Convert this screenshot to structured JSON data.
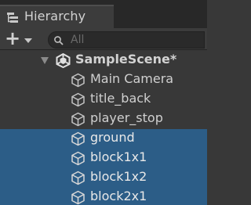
{
  "window": {
    "tab_label": "Hierarchy",
    "tab_icon": "hierarchy-icon"
  },
  "toolbar": {
    "add_icon": "plus-icon",
    "add_label": "+",
    "search_placeholder": "All",
    "search_value": ""
  },
  "scene": {
    "name": "SampleScene*",
    "expanded": true,
    "icon": "unity-scene-icon"
  },
  "items": [
    {
      "label": "Main Camera",
      "selected": false,
      "icon": "gameobject-cube-icon"
    },
    {
      "label": "title_back",
      "selected": false,
      "icon": "gameobject-cube-icon"
    },
    {
      "label": "player_stop",
      "selected": false,
      "icon": "gameobject-cube-icon"
    },
    {
      "label": "ground",
      "selected": true,
      "icon": "gameobject-cube-icon"
    },
    {
      "label": "block1x1",
      "selected": true,
      "icon": "gameobject-cube-icon"
    },
    {
      "label": "block1x2",
      "selected": true,
      "icon": "gameobject-cube-icon"
    },
    {
      "label": "block2x1",
      "selected": true,
      "icon": "gameobject-cube-icon"
    }
  ],
  "colors": {
    "panel_bg": "#383838",
    "selection": "#2c5d87",
    "text": "#d0d0d0"
  }
}
